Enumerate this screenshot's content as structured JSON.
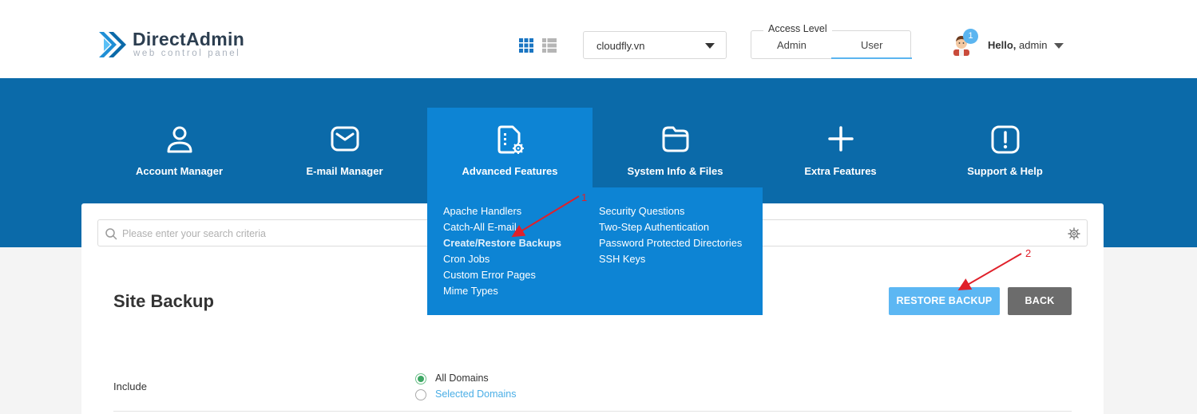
{
  "brand": {
    "name": "DirectAdmin",
    "tagline": "web control panel"
  },
  "header": {
    "domain_select": {
      "value": "cloudfly.vn"
    },
    "access_level": {
      "label": "Access Level",
      "options": [
        "Admin",
        "User"
      ],
      "selected": "User"
    },
    "notifications_count": "1",
    "greeting": "Hello,",
    "username": "admin"
  },
  "nav": {
    "items": [
      {
        "label": "Account Manager",
        "icon": "user-icon"
      },
      {
        "label": "E-mail Manager",
        "icon": "envelope-icon"
      },
      {
        "label": "Advanced Features",
        "icon": "document-gear-icon",
        "active": true
      },
      {
        "label": "System Info & Files",
        "icon": "folder-icon"
      },
      {
        "label": "Extra Features",
        "icon": "plus-icon"
      },
      {
        "label": "Support & Help",
        "icon": "exclamation-icon"
      }
    ],
    "dropdown": {
      "col1": [
        "Apache Handlers",
        "Catch-All E-mail",
        "Create/Restore Backups",
        "Cron Jobs",
        "Custom Error Pages",
        "Mime Types"
      ],
      "col2": [
        "Security Questions",
        "Two-Step Authentication",
        "Password Protected Directories",
        "SSH Keys"
      ],
      "active": "Create/Restore Backups"
    }
  },
  "search": {
    "placeholder": "Please enter your search criteria"
  },
  "page": {
    "title": "Site Backup",
    "buttons": {
      "restore": "RESTORE BACKUP",
      "back": "BACK"
    },
    "include": {
      "label": "Include",
      "options": [
        "All Domains",
        "Selected Domains"
      ],
      "selected": "All Domains"
    }
  },
  "annotations": [
    "1",
    "2"
  ],
  "colors": {
    "nav_bg": "#0b6aa9",
    "nav_active": "#0d84d4",
    "accent": "#5cb7f3",
    "back_button": "#6c6c6c",
    "annotation": "#e0202a"
  }
}
